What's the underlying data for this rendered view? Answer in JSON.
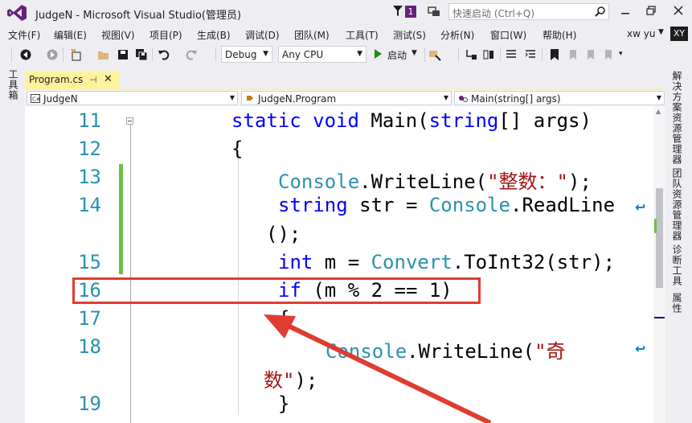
{
  "window": {
    "title": "JudgeN - Microsoft Visual Studio(管理员)",
    "notification_count": "1",
    "quick_launch_placeholder": "快速启动 (Ctrl+Q)"
  },
  "menu": [
    "文件(F)",
    "编辑(E)",
    "视图(V)",
    "项目(P)",
    "生成(B)",
    "调试(D)",
    "团队(M)",
    "工具(T)",
    "测试(S)",
    "分析(N)",
    "窗口(W)",
    "帮助(H)"
  ],
  "account": {
    "name": "xw yu",
    "initials": "XY"
  },
  "toolbar": {
    "configuration": "Debug",
    "platform": "Any CPU",
    "start_label": "启动"
  },
  "left_panel": {
    "toolbox_label": "工具箱"
  },
  "tab": {
    "label": "Program.cs",
    "pin_glyph": "⊣",
    "close_glyph": "✕"
  },
  "navbar": {
    "project": "JudgeN",
    "class": "JudgeN.Program",
    "member": "Main(string[] args)"
  },
  "right_panel": [
    "解决方案资源管理器",
    "团队资源管理器",
    "诊断工具",
    "属性"
  ],
  "code": {
    "line_numbers": [
      "11",
      "12",
      "13",
      "14",
      "15",
      "16",
      "17",
      "18",
      "19"
    ],
    "l11": {
      "kw1": "static",
      "kw2": "void",
      "name": " Main(",
      "kw3": "string",
      "rest": "[] args)"
    },
    "l12": "{",
    "l13": {
      "type": "Console",
      "call": ".WriteLine(",
      "str": "\"整数：\"",
      "end": ");"
    },
    "l14": {
      "kw": "string",
      "mid": " str = ",
      "type": "Console",
      "call": ".ReadLine"
    },
    "l14b": "();",
    "l15": {
      "kw": "int",
      "mid": " m = ",
      "type": "Convert",
      "call": ".ToInt32(str);"
    },
    "l16": {
      "kw": "if",
      "rest": " (m % 2 == 1)"
    },
    "l17": "{",
    "l18": {
      "type": "Console",
      "call": ".WriteLine(",
      "str": "\"奇"
    },
    "l18b": {
      "str": "数\"",
      "end": ");"
    },
    "l19": "}"
  },
  "colors": {
    "accent": "#68217a",
    "annotation": "#e03c31",
    "change_bar": "#6cc048",
    "tab_active": "#fff29d"
  }
}
